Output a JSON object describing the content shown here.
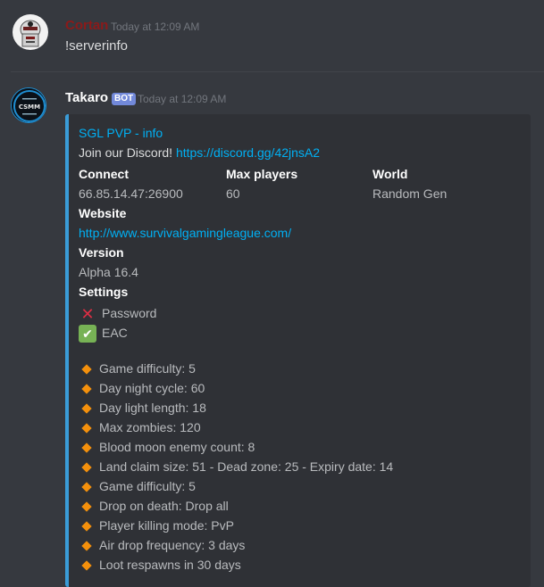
{
  "messages": [
    {
      "author": "Cortan",
      "timestamp": "Today at 12:09 AM",
      "text": "!serverinfo",
      "avatar_icon": "robot-avatar-icon",
      "name_color": "#8b1a1a"
    },
    {
      "author": "Takaro",
      "badge": "BOT",
      "timestamp": "Today at 12:09 AM",
      "avatar_icon": "csmm-logo-avatar-icon",
      "name_color": "#ffffff",
      "embed": {
        "accent_color": "#3a9cd8",
        "title": "SGL PVP - info",
        "description_text": "Join our Discord!",
        "description_link": "https://discord.gg/42jnsA2",
        "fields": {
          "connect": {
            "name": "Connect",
            "value": "66.85.14.47:26900"
          },
          "max_players": {
            "name": "Max players",
            "value": "60"
          },
          "world": {
            "name": "World",
            "value": "Random Gen"
          },
          "website": {
            "name": "Website",
            "value": "http://www.survivalgamingleague.com/"
          },
          "version": {
            "name": "Version",
            "value": "Alpha 16.4"
          },
          "settings": {
            "name": "Settings"
          }
        },
        "settings": [
          {
            "label": "Password",
            "icon": "cross-mark-icon",
            "enabled": false
          },
          {
            "label": "EAC",
            "icon": "check-mark-icon",
            "enabled": true
          }
        ],
        "stats": [
          "Game difficulty: 5",
          "Day night cycle: 60",
          "Day light length: 18",
          "Max zombies: 120",
          "Blood moon enemy count: 8",
          "Land claim size: 51 - Dead zone: 25 - Expiry date: 14",
          "Game difficulty: 5",
          "Drop on death: Drop all",
          "Player killing mode: PvP",
          "Air drop frequency: 3 days",
          "Loot respawns in 30 days"
        ]
      }
    }
  ]
}
